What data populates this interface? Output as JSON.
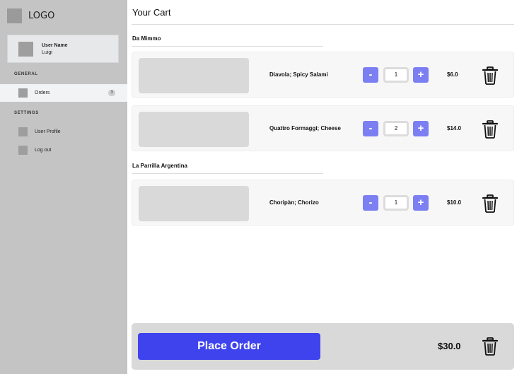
{
  "sidebar": {
    "logo": "LOGO",
    "user": {
      "title": "User Name",
      "name": "Luigi"
    },
    "sections": {
      "general": "GENERAL",
      "settings": "SETTINGS"
    },
    "items": {
      "orders": {
        "label": "Orders",
        "badge": "3"
      },
      "profile": {
        "label": "User Profile"
      },
      "logout": {
        "label": "Log out"
      }
    }
  },
  "main": {
    "title": "Your Cart",
    "restaurants": [
      {
        "name": "Da Mimmo",
        "items": [
          {
            "name": "Diavola; Spicy Salami",
            "quantity": "1",
            "price": "$6.0"
          },
          {
            "name": "Quattro Formaggi; Cheese",
            "quantity": "2",
            "price": "$14.0"
          }
        ]
      },
      {
        "name": "La Parrilla Argentina",
        "items": [
          {
            "name": "Choripàn; Chorizo",
            "quantity": "1",
            "price": "$10.0"
          }
        ]
      }
    ],
    "qty_minus": "-",
    "qty_plus": "+"
  },
  "footer": {
    "place_order": "Place Order",
    "total": "$30.0"
  },
  "colors": {
    "sidebar_bg": "#c4c4c4",
    "accent": "#3f43ee",
    "qty_button": "#7b7ff2"
  },
  "icons": {
    "delete": "trash-icon",
    "logo": "logo-placeholder",
    "avatar": "avatar-placeholder"
  }
}
